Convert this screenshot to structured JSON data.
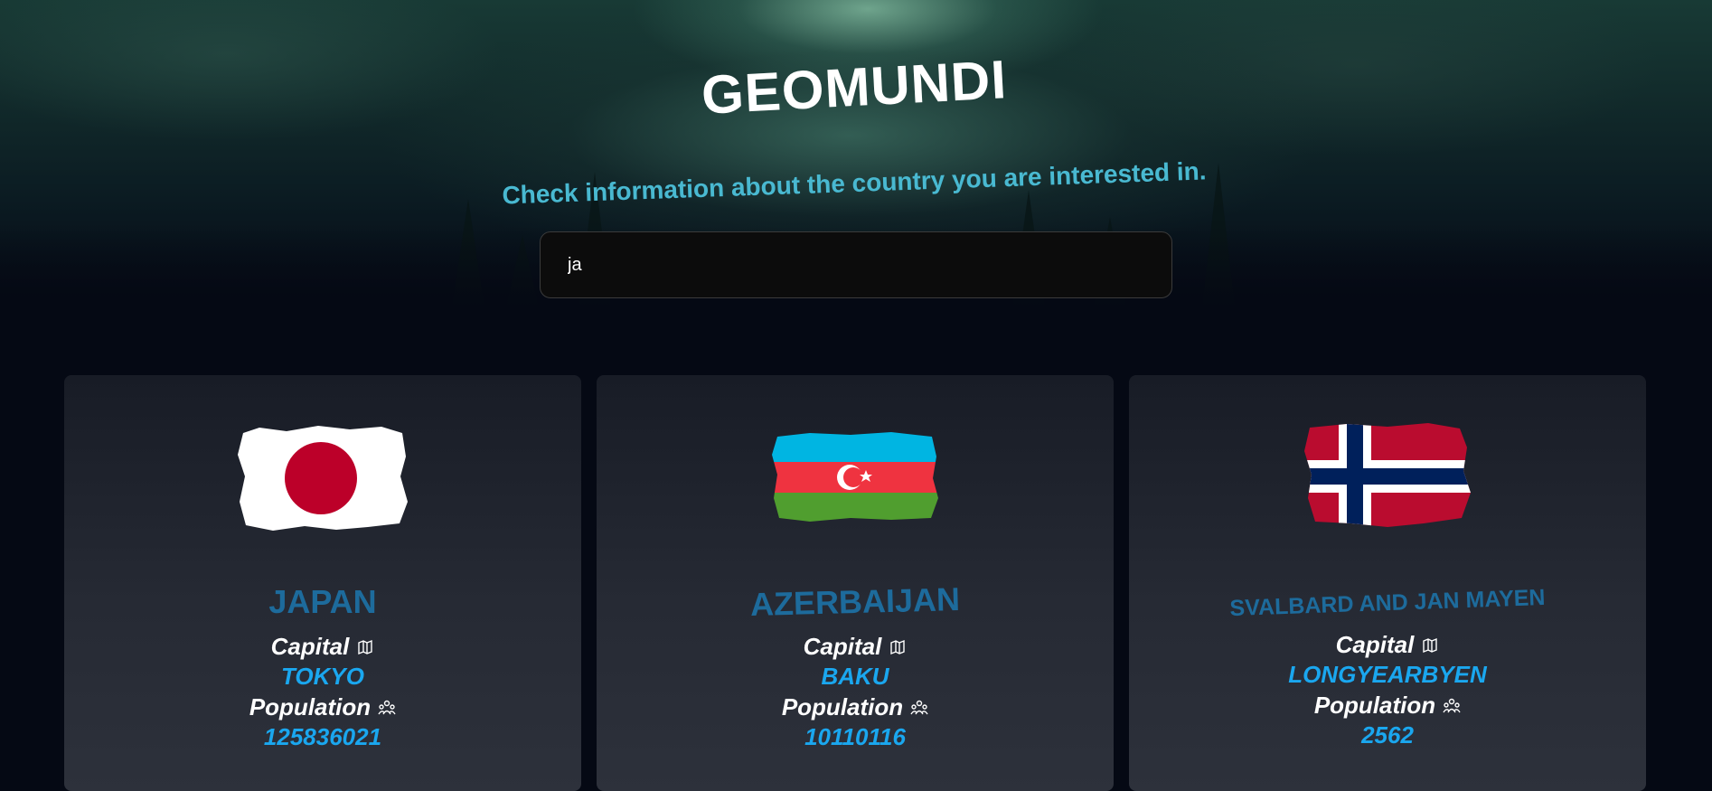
{
  "app": {
    "title": "GEOMUNDI",
    "subtitle": "Check information about the country you are interested in."
  },
  "search": {
    "value": "ja"
  },
  "labels": {
    "capital": "Capital",
    "population": "Population"
  },
  "icons": {
    "capital": "map-pin-icon",
    "population": "people-icon"
  },
  "colors": {
    "country_name": "#1d6b9c",
    "value": "#1aa7ef",
    "subtitle": "#49b9d1"
  },
  "countries": [
    {
      "name": "JAPAN",
      "capital": "TOKYO",
      "population": "125836021",
      "flag": "japan-flag"
    },
    {
      "name": "AZERBAIJAN",
      "capital": "BAKU",
      "population": "10110116",
      "flag": "azerbaijan-flag"
    },
    {
      "name": "SVALBARD AND JAN MAYEN",
      "capital": "LONGYEARBYEN",
      "population": "2562",
      "flag": "norway-flag"
    }
  ]
}
